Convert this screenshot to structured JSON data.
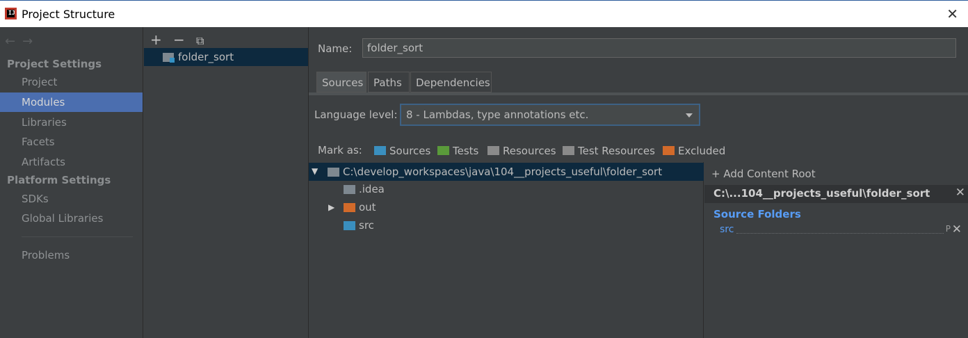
{
  "window": {
    "title": "Project Structure",
    "icon": "intellij-icon",
    "close_icon": "close-icon"
  },
  "nav": {
    "back_icon": "arrow-left-icon",
    "forward_icon": "arrow-right-icon"
  },
  "sidebar": {
    "project_settings_label": "Project Settings",
    "platform_settings_label": "Platform Settings",
    "project_items": [
      "Project",
      "Modules",
      "Libraries",
      "Facets",
      "Artifacts"
    ],
    "platform_items": [
      "SDKs",
      "Global Libraries"
    ],
    "problems_label": "Problems",
    "selected": "Modules"
  },
  "modules": {
    "toolbar": {
      "add_icon": "plus-icon",
      "remove_icon": "minus-icon",
      "copy_icon": "copy-icon"
    },
    "list": [
      "folder_sort"
    ]
  },
  "module": {
    "name_label": "Name:",
    "name_value": "folder_sort",
    "tabs": [
      "Sources",
      "Paths",
      "Dependencies"
    ],
    "active_tab": "Sources",
    "language_level_label": "Language level:",
    "language_level_value": "8 - Lambdas, type annotations etc.",
    "mark_as_label": "Mark as:",
    "mark_as": [
      {
        "label": "Sources",
        "color": "#3a8fbf"
      },
      {
        "label": "Tests",
        "color": "#5a9a3a"
      },
      {
        "label": "Resources",
        "color": "#8a8a8a"
      },
      {
        "label": "Test Resources",
        "color": "#8a8a8a"
      },
      {
        "label": "Excluded",
        "color": "#d26a2a"
      }
    ]
  },
  "tree": {
    "root": "C:\\develop_workspaces\\java\\104__projects_useful\\folder_sort",
    "children": [
      {
        "name": ".idea",
        "color": "#7e8890",
        "expandable": false
      },
      {
        "name": "out",
        "color": "#d26a2a",
        "expandable": true
      },
      {
        "name": "src",
        "color": "#3a8fbf",
        "expandable": false
      }
    ]
  },
  "content_root": {
    "add_label": "Add Content Root",
    "path": "C:\\...104__projects_useful\\folder_sort",
    "source_folders_label": "Source Folders",
    "source_folders": [
      "src"
    ],
    "properties_glyph": "P",
    "remove_icon": "close-icon"
  }
}
